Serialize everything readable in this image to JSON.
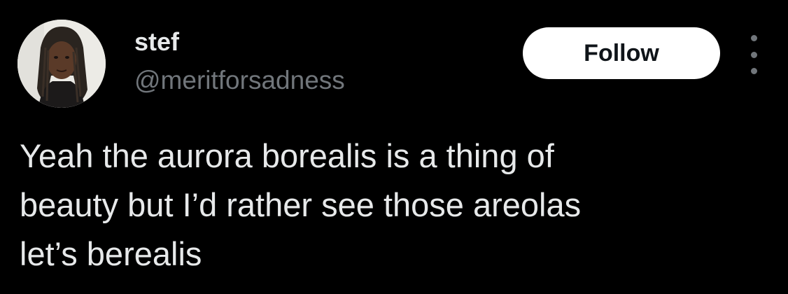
{
  "author": {
    "display_name": "stef",
    "handle": "@meritforsadness",
    "avatar_icon": "profile-photo"
  },
  "actions": {
    "follow_label": "Follow",
    "more_icon": "more-options-icon"
  },
  "tweet": {
    "lines": [
      "Yeah the aurora borealis is a thing of",
      "beauty but I’d rather see those areolas",
      "let’s berealis"
    ]
  },
  "colors": {
    "background": "#000000",
    "text_primary": "#e7e9ea",
    "text_secondary": "#71767b",
    "button_bg": "#ffffff",
    "button_text": "#0f1419"
  }
}
